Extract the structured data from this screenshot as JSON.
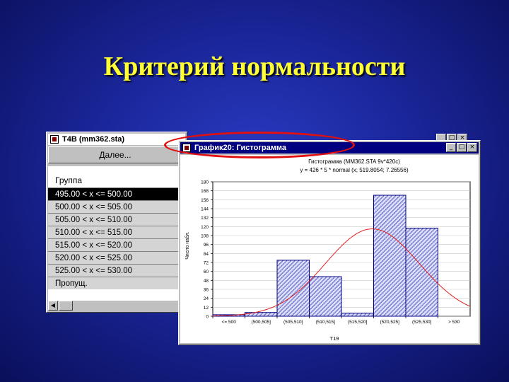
{
  "slide": {
    "title": "Критерий нормальности"
  },
  "table_window": {
    "title": "T4B (mm362.sta)",
    "next_button": "Далее...",
    "header": "Группа",
    "rows": [
      "495.00 < x <= 500.00",
      "500.00 < x <= 505.00",
      "505.00 < x <= 510.00",
      "510.00 < x <= 515.00",
      "515.00 < x <= 520.00",
      "520.00 < x <= 525.00",
      "525.00 < x <= 530.00",
      "Пропущ."
    ],
    "selected_row": 0,
    "buttons": {
      "minimize": "_",
      "maximize": "□",
      "close": "×"
    }
  },
  "chart_window": {
    "title": "График20: Гистограмма",
    "buttons": {
      "minimize": "_",
      "maximize": "□",
      "close": "×"
    }
  },
  "chart_data": {
    "type": "bar",
    "title": "Гистограмма (MM362.STA 9v*420c)",
    "subtitle": "у = 426 * 5 * normal (x; 519.8054; 7.26556)",
    "xlabel": "T19",
    "ylabel": "Число набл.",
    "categories": [
      "<= 500",
      "(500,505]",
      "(505,510]",
      "(510,515]",
      "(515,520]",
      "(520,525]",
      "(525,530]",
      "> 530"
    ],
    "values": [
      2,
      5,
      75,
      53,
      4,
      162,
      118,
      0
    ],
    "yticks": [
      "0",
      "12",
      "24",
      "36",
      "48",
      "60",
      "72",
      "84",
      "96",
      "108",
      "120",
      "132",
      "144",
      "156",
      "168",
      "180"
    ],
    "ylim": [
      0,
      180
    ],
    "fit_curve": {
      "type": "normal",
      "n": 426,
      "bin_width": 5,
      "mean": 519.8054,
      "sd": 7.26556,
      "x_start": 495
    },
    "colors": {
      "bar_fill": "#d8dcf8",
      "bar_stroke": "#000080",
      "hatch": "#1010a0",
      "curve": "#e02020"
    }
  }
}
